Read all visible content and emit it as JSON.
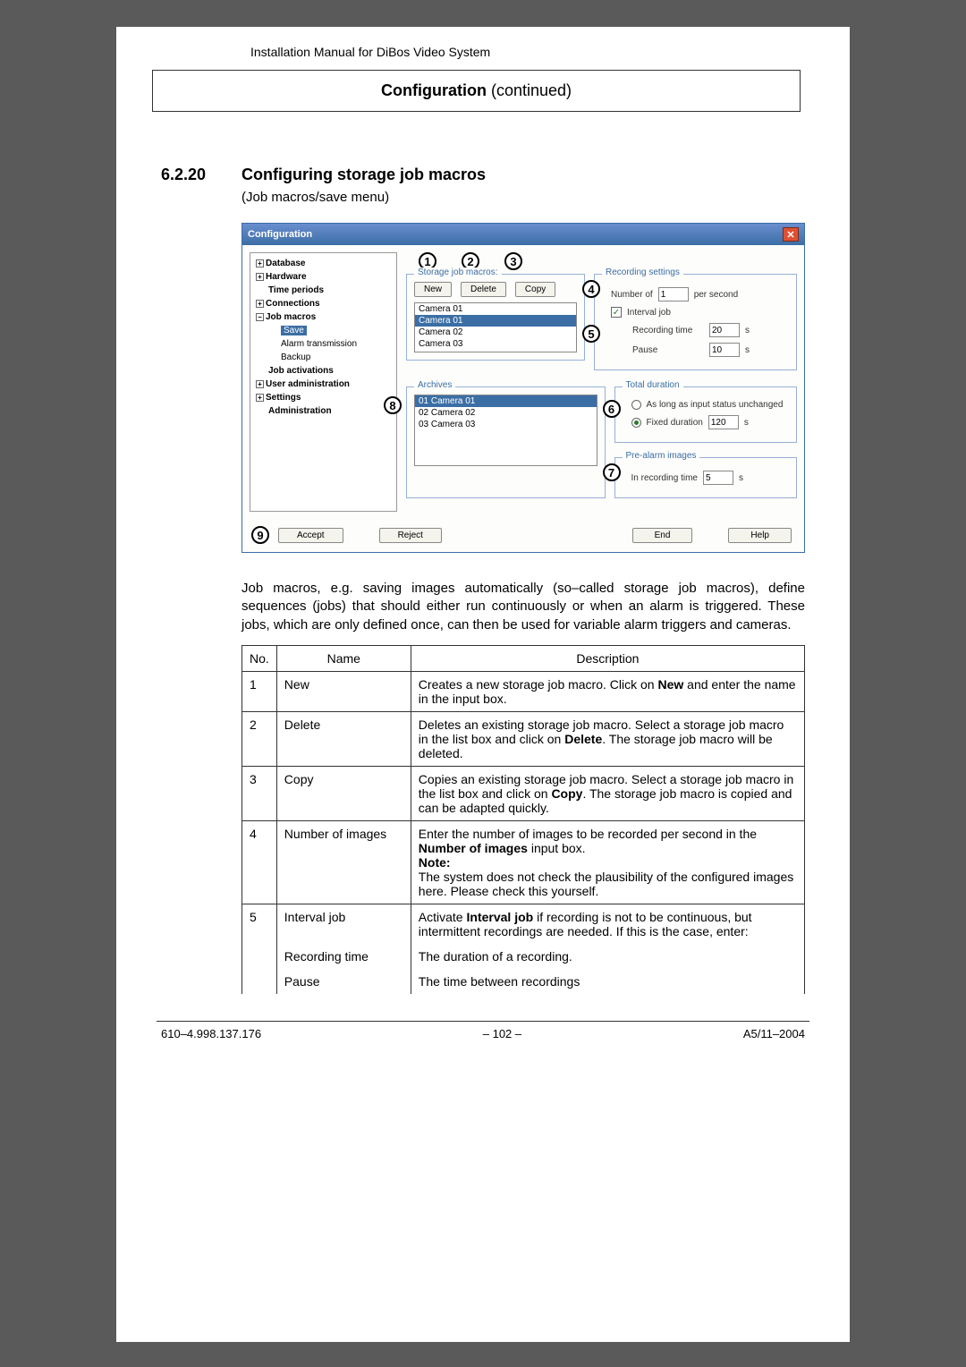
{
  "header": {
    "manual_title": "Installation Manual for DiBos Video System"
  },
  "page_title": {
    "main": "Configuration",
    "cont": "  (continued)"
  },
  "section": {
    "number": "6.2.20",
    "heading": "Configuring storage job macros",
    "sub": "(Job macros/save menu)"
  },
  "dialog": {
    "title": "Configuration",
    "tree": {
      "items": [
        "Database",
        "Hardware",
        "Time periods",
        "Connections",
        "Job macros",
        "Save",
        "Alarm transmission",
        "Backup",
        "Job activations",
        "User administration",
        "Settings",
        "Administration"
      ]
    },
    "macros": {
      "legend": "Storage job macros:",
      "buttons": {
        "new": "New",
        "del": "Delete",
        "copy": "Copy"
      },
      "list": [
        "Camera 01",
        "Camera 01",
        "Camera 02",
        "Camera 03"
      ]
    },
    "recording": {
      "legend": "Recording settings",
      "number_of_lbl": "Number of",
      "number_of_val": "1",
      "per_second": "per second",
      "interval_lbl": "Interval job",
      "rectime_lbl": "Recording time",
      "rectime_val": "20",
      "pause_lbl": "Pause",
      "pause_val": "10",
      "unit": "s"
    },
    "archives": {
      "legend": "Archives",
      "rows": [
        "01  Camera 01",
        "02  Camera 02",
        "03  Camera 03"
      ]
    },
    "total": {
      "legend": "Total duration",
      "opt_unchanged": "As long as input status unchanged",
      "opt_fixed": "Fixed duration",
      "fixed_val": "120",
      "unit": "s"
    },
    "prealarm": {
      "legend": "Pre-alarm images",
      "lbl": "In recording time",
      "val": "5",
      "unit": "s"
    },
    "bottom": {
      "accept": "Accept",
      "reject": "Reject",
      "end": "End",
      "help": "Help"
    }
  },
  "paragraph": "Job macros, e.g. saving images automatically (so–called storage job macros), define sequences (jobs) that should either run continuously or when an alarm is triggered. These jobs, which are only defined once, can then be used for variable alarm triggers and cameras.",
  "table": {
    "head": {
      "no": "No.",
      "name": "Name",
      "desc": "Description"
    },
    "rows": [
      {
        "no": "1",
        "name": "New",
        "desc_parts": [
          "Creates a new storage job macro.\nClick on ",
          "New",
          " and enter the name in the input box."
        ]
      },
      {
        "no": "2",
        "name": "Delete",
        "desc_parts": [
          "Deletes an existing storage job macro.\nSelect a storage job macro in the list box and click on ",
          "Delete",
          ". The storage job macro will be deleted."
        ]
      },
      {
        "no": "3",
        "name": "Copy",
        "desc_parts": [
          "Copies an existing storage job macro.\nSelect a storage job macro in the list box and click on ",
          "Copy",
          ". The storage job macro is copied and can be adapted quickly."
        ]
      },
      {
        "no": "4",
        "name": "Number of images",
        "desc4_a": "Enter the number of images to be recorded per second in the ",
        "desc4_b": "Number of images",
        "desc4_c": " input box.",
        "desc4_note": "Note:",
        "desc4_d": "The system does not check the plausibility of the configured images here. Please check this yourself."
      },
      {
        "no": "5",
        "name": "Interval job",
        "desc5_a": "Activate ",
        "desc5_b": "Interval job",
        "desc5_c": " if recording is not to be continuous, but intermittent recordings are needed. If this is the case, enter:",
        "sub1_name": "Recording time",
        "sub1_desc": "The duration of a recording.",
        "sub2_name": "Pause",
        "sub2_desc": "The time between recordings"
      }
    ]
  },
  "footer": {
    "left": "610–4.998.137.176",
    "center": "–  102  –",
    "right": "A5/11–2004"
  }
}
